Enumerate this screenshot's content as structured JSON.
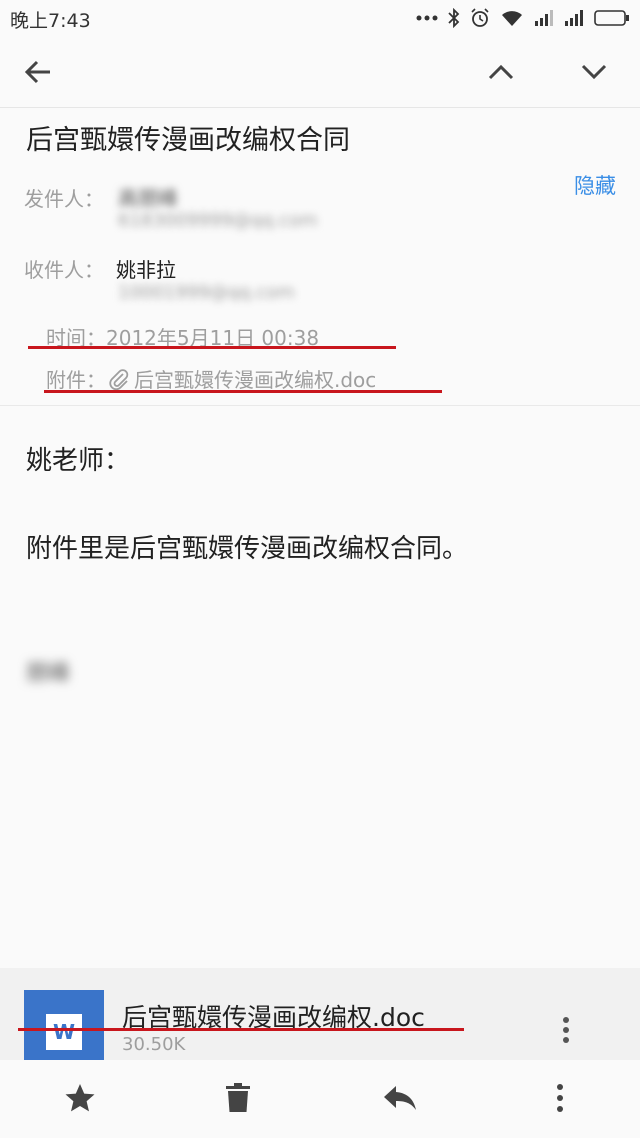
{
  "status_bar": {
    "time": "晚上7:43",
    "icons": [
      "dots-icon",
      "bluetooth-icon",
      "alarm-icon",
      "wifi-icon",
      "signal-icon",
      "signal-icon",
      "battery-icon"
    ]
  },
  "toolbar": {
    "back_icon": "arrow-left-icon",
    "prev_icon": "chevron-up-icon",
    "next_icon": "chevron-down-icon"
  },
  "email": {
    "subject": "后宫甄嬛传漫画改编权合同",
    "hide_label": "隐藏",
    "sender_label": "发件人：",
    "sender_name": "高朋峰",
    "sender_email": "6183009999@qq.com",
    "recipient_label": "收件人：",
    "recipient_name": "姚非拉",
    "recipient_email": "10001999@qq.com",
    "time_line": "时间：2012年5月11日 00:38",
    "attachment_label": "附件：",
    "attachment_inline": "后宫甄嬛传漫画改编权.doc",
    "greeting": "姚老师：",
    "body": "附件里是后宫甄嬛传漫画改编权合同。",
    "signature": "朋峰"
  },
  "attachment": {
    "icon_letter": "W",
    "file_name": "后宫甄嬛传漫画改编权.doc",
    "file_size": "30.50K"
  },
  "colors": {
    "accent": "#3a8ee6",
    "underline": "#c8161d",
    "word_blue": "#3a74c9"
  }
}
